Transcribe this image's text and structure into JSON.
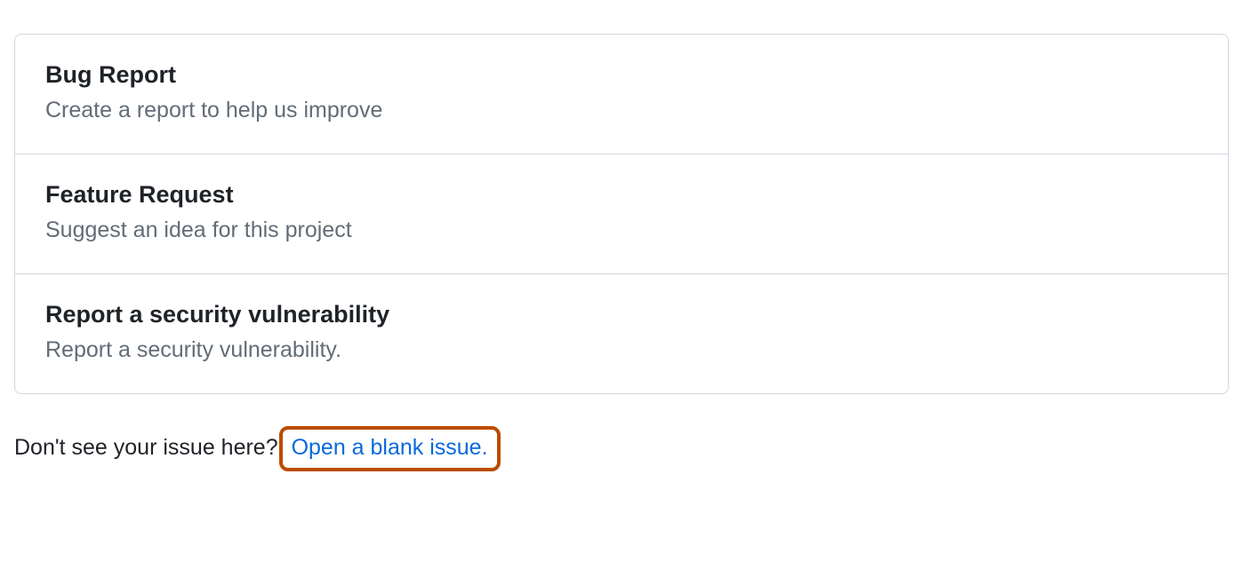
{
  "templates": [
    {
      "title": "Bug Report",
      "description": "Create a report to help us improve"
    },
    {
      "title": "Feature Request",
      "description": "Suggest an idea for this project"
    },
    {
      "title": "Report a security vulnerability",
      "description": "Report a security vulnerability."
    }
  ],
  "footer": {
    "prompt": "Don't see your issue here?",
    "link_text": "Open a blank issue."
  }
}
